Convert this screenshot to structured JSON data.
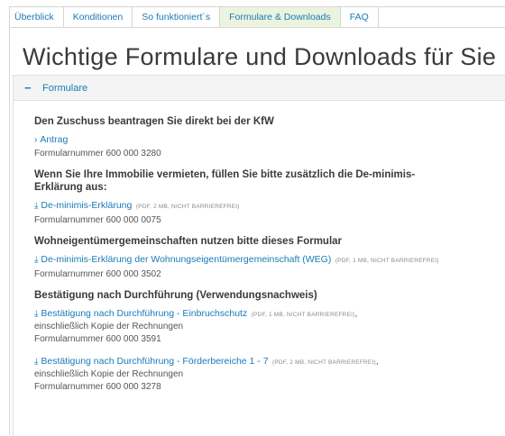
{
  "tabs": [
    {
      "label": "Überblick"
    },
    {
      "label": "Konditionen"
    },
    {
      "label": "So funktioniert´s"
    },
    {
      "label": "Formulare & Downloads"
    },
    {
      "label": "FAQ"
    }
  ],
  "page_title": "Wichtige Formulare und Downloads für Sie",
  "panel": {
    "toggle": "−",
    "title": "Formulare"
  },
  "sections": [
    {
      "heading": "Den Zuschuss beantragen Sie direkt bei der KfW",
      "items": [
        {
          "icon": "›",
          "link": "Antrag",
          "number": "Formularnummer 600 000 3280"
        }
      ]
    },
    {
      "heading": "Wenn Sie Ihre Immobilie vermieten, füllen Sie bitte zusätzlich die De-minimis-Erklärung aus:",
      "items": [
        {
          "icon": "⤓",
          "link": "De-minimis-Erklärung",
          "meta": "(PDF, 2 MB, NICHT BARRIEREFREI)",
          "number": "Formularnummer 600 000 0075"
        }
      ]
    },
    {
      "heading": "Wohneigentümergemeinschaften nutzen bitte dieses Formular",
      "items": [
        {
          "icon": "⤓",
          "link": "De-minimis-Erklärung der Wohnungseigentümergemeinschaft (WEG)",
          "meta": "(PDF, 1 MB, NICHT BARRIEREFREI)",
          "number": "Formularnummer 600 000 3502"
        }
      ]
    },
    {
      "heading": "Bestätigung nach Durchführung (Verwendungsnachweis)",
      "items": [
        {
          "icon": "⤓",
          "link": "Bestätigung nach Durchführung - Einbruchschutz",
          "meta": "(PDF, 1 MB, NICHT BARRIEREFREI)",
          "trailing": ",",
          "sub": "einschließlich Kopie der Rechnungen",
          "number": "Formularnummer 600 000 3591"
        },
        {
          "icon": "⤓",
          "link": "Bestätigung nach Durchführung - Förderbereiche 1 - 7",
          "meta": "(PDF, 2 MB, NICHT BARRIEREFREI)",
          "trailing": ",",
          "sub": "einschließlich Kopie der Rechnungen",
          "number": "Formularnummer 600 000 3278"
        }
      ]
    }
  ],
  "colors": {
    "link": "#1a7ab7",
    "active_tab_bg": "#ecf3df",
    "heading": "#3a3a3a"
  }
}
